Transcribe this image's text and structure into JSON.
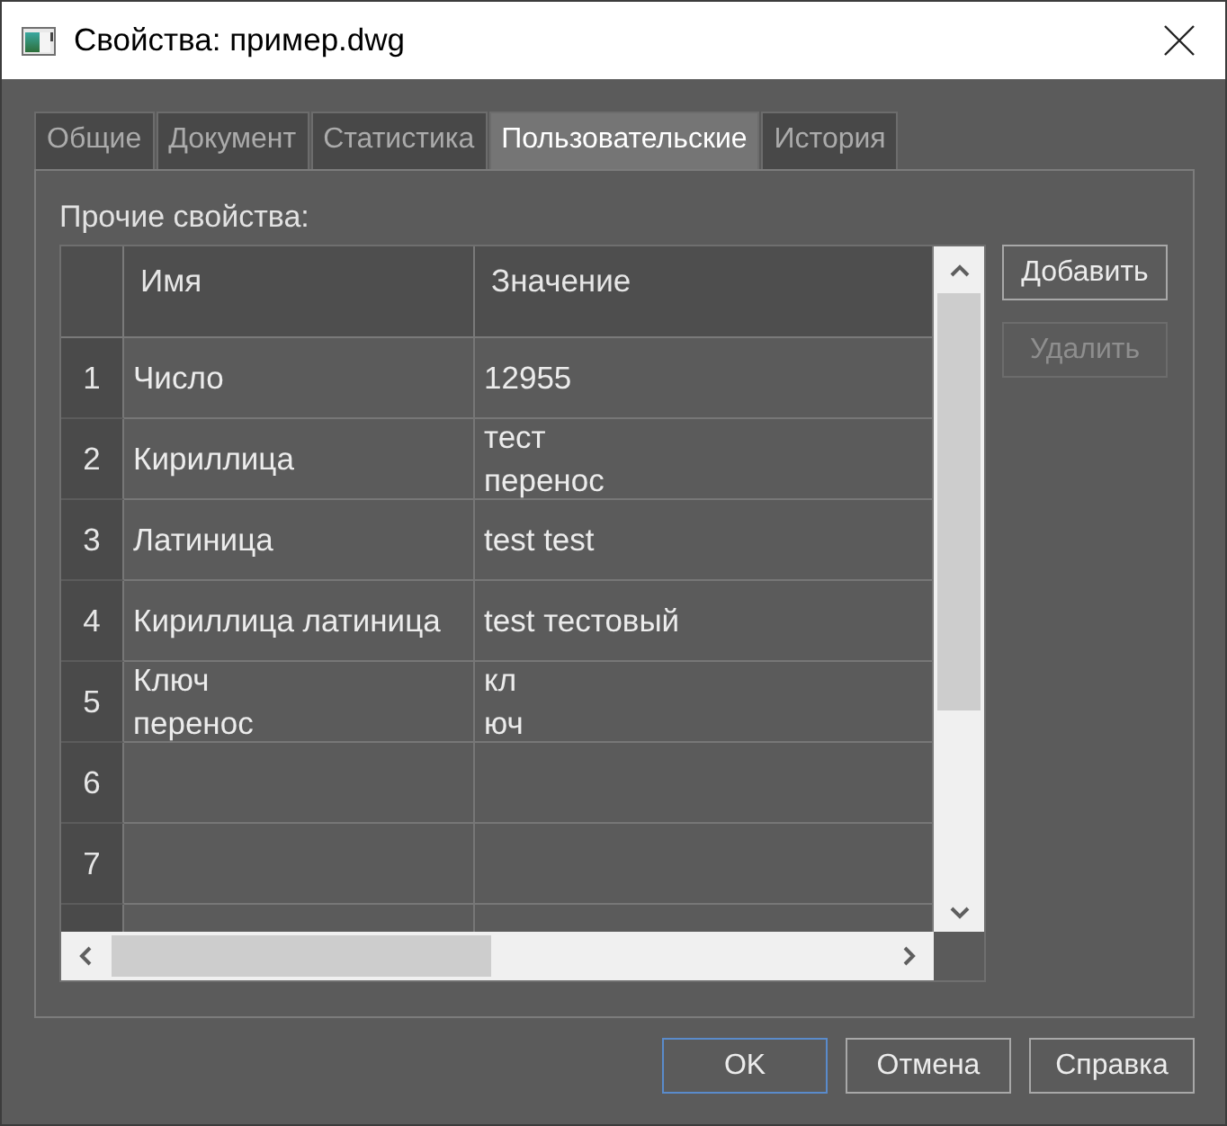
{
  "window": {
    "title": "Свойства: пример.dwg"
  },
  "tabs": [
    {
      "label": "Общие",
      "selected": false
    },
    {
      "label": "Документ",
      "selected": false
    },
    {
      "label": "Статистика",
      "selected": false
    },
    {
      "label": "Пользовательские",
      "selected": true
    },
    {
      "label": "История",
      "selected": false
    }
  ],
  "custom_properties": {
    "label": "Прочие свойства:",
    "table": {
      "columns": [
        "Имя",
        "Значение"
      ],
      "rows": [
        {
          "number": "1",
          "name": "Число",
          "value": "12955"
        },
        {
          "number": "2",
          "name": "Кириллица",
          "value": "тест\nперенос"
        },
        {
          "number": "3",
          "name": "Латиница",
          "value": "test test"
        },
        {
          "number": "4",
          "name": "Кириллица латиница",
          "value": "test тестовый"
        },
        {
          "number": "5",
          "name": "Ключ\nперенос",
          "value": "кл\nюч"
        },
        {
          "number": "6"
        },
        {
          "number": "7"
        }
      ]
    },
    "side_buttons": [
      {
        "label": "Добавить",
        "disabled": false
      },
      {
        "label": "Удалить",
        "disabled": true
      }
    ]
  },
  "footer_buttons": [
    {
      "label": "OK",
      "default": true
    },
    {
      "label": "Отмена",
      "default": false
    },
    {
      "label": "Справка",
      "default": false
    }
  ]
}
